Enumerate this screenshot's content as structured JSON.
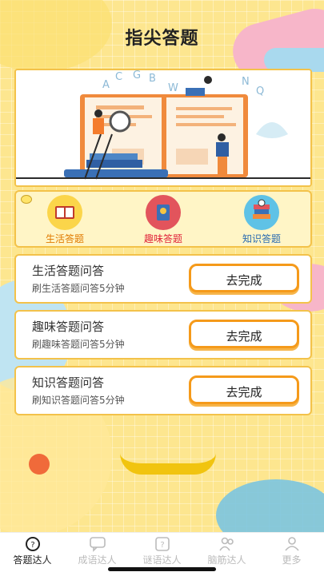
{
  "header": {
    "title": "指尖答题"
  },
  "categories": [
    {
      "label": "生活答题",
      "color": "#e07a00"
    },
    {
      "label": "趣味答题",
      "color": "#e0233a"
    },
    {
      "label": "知识答题",
      "color": "#2a6bb0"
    }
  ],
  "tasks": [
    {
      "title": "生活答题问答",
      "subtitle": "刷生活答题问答5分钟",
      "button": "去完成"
    },
    {
      "title": "趣味答题问答",
      "subtitle": "刷趣味答题问答5分钟",
      "button": "去完成"
    },
    {
      "title": "知识答题问答",
      "subtitle": "刷知识答题问答5分钟",
      "button": "去完成"
    }
  ],
  "tabbar": [
    {
      "label": "答题达人",
      "active": true
    },
    {
      "label": "成语达人",
      "active": false
    },
    {
      "label": "谜语达人",
      "active": false
    },
    {
      "label": "脑筋达人",
      "active": false
    },
    {
      "label": "更多",
      "active": false
    }
  ],
  "hero": {
    "letters": [
      "A",
      "C",
      "G",
      "B",
      "W",
      "N",
      "Q"
    ]
  }
}
